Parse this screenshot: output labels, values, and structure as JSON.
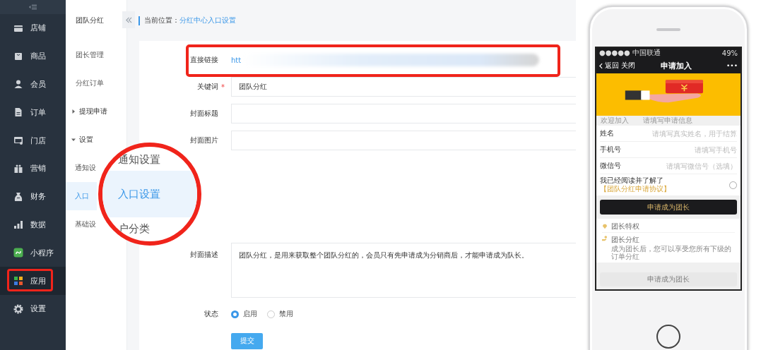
{
  "sidebar": {
    "items": [
      {
        "label": "店铺",
        "kind": "store",
        "selected": false,
        "highlighted": false
      },
      {
        "label": "商品",
        "kind": "goods",
        "selected": false,
        "highlighted": false
      },
      {
        "label": "会员",
        "kind": "member",
        "selected": false,
        "highlighted": false
      },
      {
        "label": "订单",
        "kind": "order",
        "selected": false,
        "highlighted": false
      },
      {
        "label": "门店",
        "kind": "shop",
        "selected": false,
        "highlighted": false
      },
      {
        "label": "营销",
        "kind": "gift",
        "selected": false,
        "highlighted": false
      },
      {
        "label": "财务",
        "kind": "money",
        "selected": false,
        "highlighted": false
      },
      {
        "label": "数据",
        "kind": "data",
        "selected": false,
        "highlighted": false
      },
      {
        "label": "小程序",
        "kind": "miniapp",
        "selected": false,
        "highlighted": false
      },
      {
        "label": "应用",
        "kind": "apps",
        "selected": true,
        "highlighted": true
      },
      {
        "label": "设置",
        "kind": "settings",
        "selected": false,
        "highlighted": false
      }
    ]
  },
  "submenu": {
    "title": "团队分红",
    "items": [
      {
        "label": "团长管理",
        "kind": "link",
        "selected": false
      },
      {
        "label": "分红订单",
        "kind": "link",
        "selected": false
      },
      {
        "label": "提现申请",
        "kind": "group",
        "expanded": false
      },
      {
        "label": "设置",
        "kind": "group",
        "expanded": true
      },
      {
        "label": "通知设",
        "kind": "link",
        "selected": false
      },
      {
        "label": "入口",
        "kind": "link",
        "selected": true
      },
      {
        "label": "基础设",
        "kind": "link",
        "selected": false
      }
    ]
  },
  "magnifier": {
    "items": [
      {
        "label": "通知设置",
        "selected": false
      },
      {
        "label": "入口设置",
        "selected": true
      },
      {
        "label": "户分类",
        "selected": false
      }
    ]
  },
  "breadcrumb": {
    "prefix": "当前位置：",
    "current": "分红中心入口设置"
  },
  "form": {
    "fields": [
      {
        "label": "直接链接",
        "kind": "link",
        "value": "htt",
        "highlighted": true
      },
      {
        "label": "关键词",
        "kind": "input",
        "required": true,
        "value": "团队分红"
      },
      {
        "label": "封面标题",
        "kind": "input",
        "required": false
      },
      {
        "label": "封面图片",
        "kind": "image",
        "required": false
      },
      {
        "label": "封面描述",
        "kind": "textarea",
        "required": false,
        "value": "团队分红，是用来获取整个团队分红的，会员只有先申请成为分销商后，才能申请成为队长。"
      }
    ],
    "status": {
      "label": "状态",
      "options": [
        {
          "label": "启用",
          "selected": true
        },
        {
          "label": "禁用",
          "selected": false
        }
      ]
    },
    "required_mark": "*",
    "submit": "提交"
  },
  "phone": {
    "status_bar": {
      "carrier": "●●●●● 中国联通",
      "battery": "49%"
    },
    "nav": {
      "back": "返回",
      "close": "关闭",
      "title": "申请加入",
      "more": "•••"
    },
    "steps": [
      "欢迎加入",
      "请填写申请信息"
    ],
    "fields": [
      {
        "label": "姓名",
        "placeholder": "请填写真实姓名，用于结算"
      },
      {
        "label": "手机号",
        "placeholder": "请填写手机号"
      },
      {
        "label": "微信号",
        "placeholder": "请填写微信号（选填）"
      }
    ],
    "agreement": {
      "text": "我已经阅读并了解了",
      "link": "【团队分红申请协议】",
      "checked": false
    },
    "apply_button": "申请成为团长",
    "privileges": {
      "title": "团长特权",
      "items": [
        {
          "title": "团长分红",
          "description": "成为团长后，您可以享受您所有下级的订单分红"
        }
      ]
    },
    "bottom_button": {
      "label": "申请成为团长",
      "disabled": true
    }
  }
}
